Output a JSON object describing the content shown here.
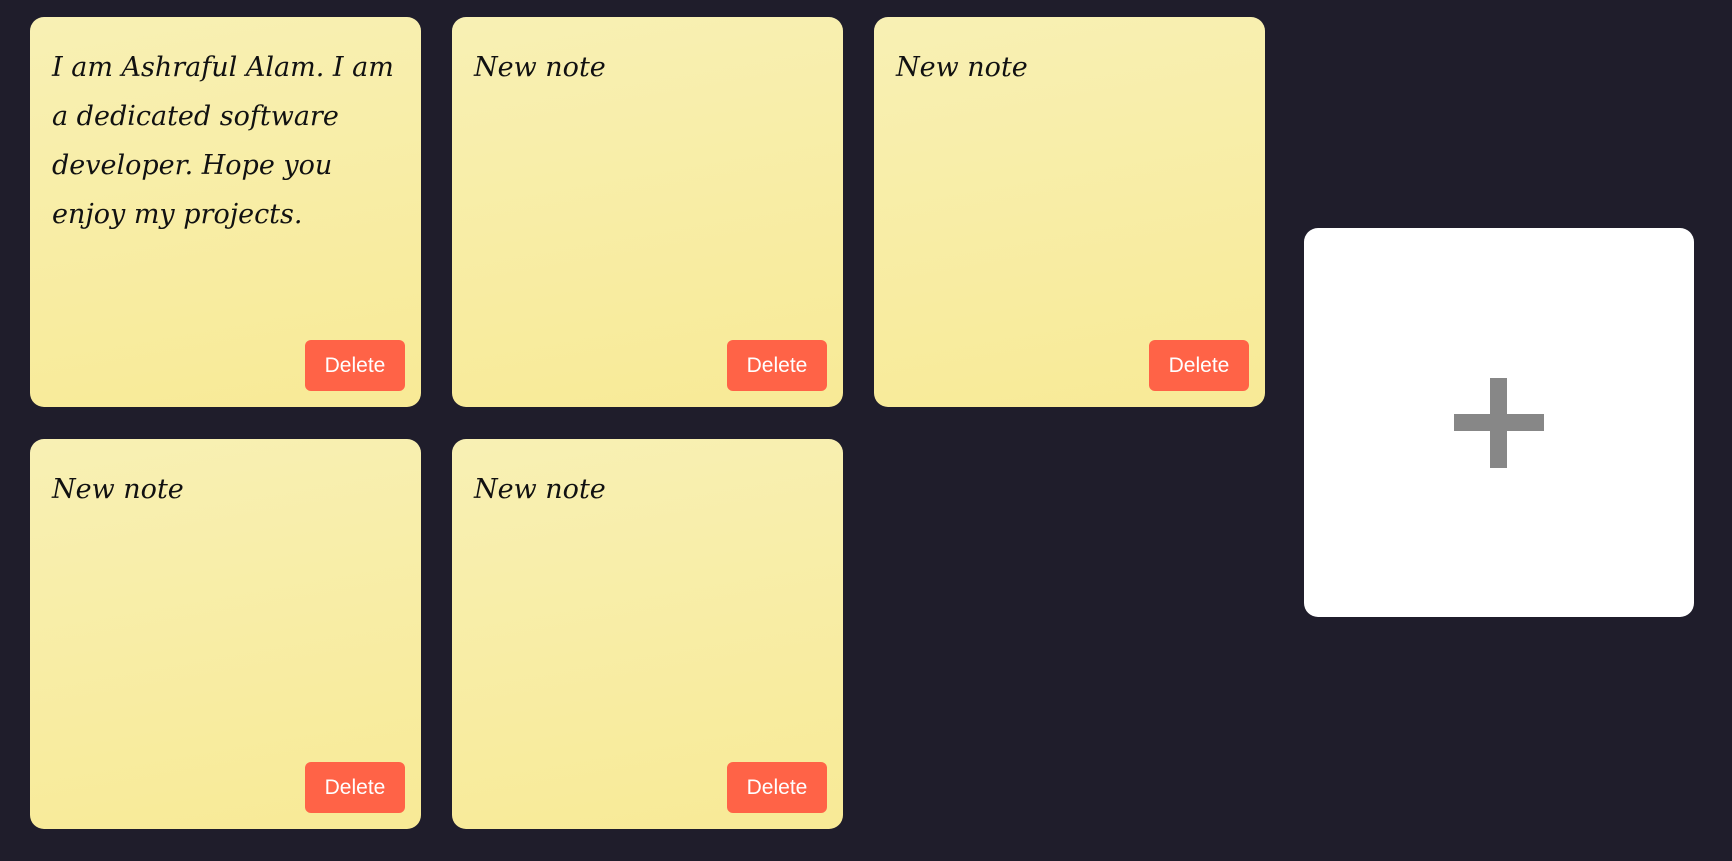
{
  "notes": [
    {
      "text": "I am Ashraful Alam. I am a dedicated software developer. Hope you enjoy my projects.",
      "delete_label": "Delete"
    },
    {
      "text": "New note",
      "delete_label": "Delete"
    },
    {
      "text": "New note",
      "delete_label": "Delete"
    },
    {
      "text": "New note",
      "delete_label": "Delete"
    },
    {
      "text": "New note",
      "delete_label": "Delete"
    }
  ],
  "add_note": {
    "icon": "plus-icon"
  },
  "colors": {
    "background": "#1f1d2b",
    "note": "#f8ea96",
    "delete_button": "#ff6347",
    "add_card": "#ffffff",
    "plus": "#878787"
  }
}
